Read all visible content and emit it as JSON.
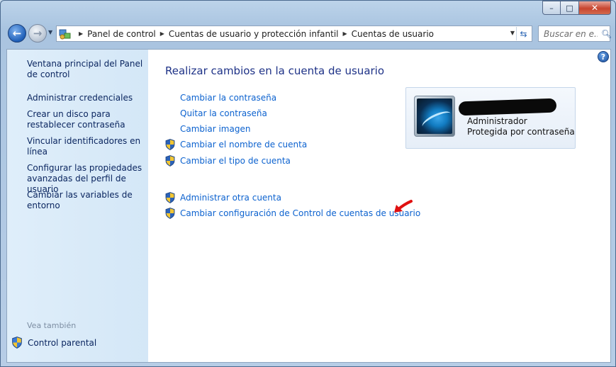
{
  "address": {
    "crumbs": [
      "Panel de control",
      "Cuentas de usuario y protección infantil",
      "Cuentas de usuario"
    ]
  },
  "search": {
    "placeholder": "Buscar en e..."
  },
  "sidebar": {
    "items": [
      {
        "label": "Ventana principal del Panel de control"
      },
      {
        "label": "Administrar credenciales"
      },
      {
        "label": "Crear un disco para restablecer contraseña"
      },
      {
        "label": "Vincular identificadores en línea"
      },
      {
        "label": "Configurar las propiedades avanzadas del perfil de usuario"
      },
      {
        "label": "Cambiar las variables de entorno"
      }
    ],
    "see_also_label": "Vea también",
    "parental_label": "Control parental"
  },
  "main": {
    "heading": "Realizar cambios en la cuenta de usuario",
    "links": [
      {
        "label": "Cambiar la contraseña"
      },
      {
        "label": "Quitar la contraseña"
      },
      {
        "label": "Cambiar imagen"
      },
      {
        "label": "Cambiar el nombre de cuenta"
      },
      {
        "label": "Cambiar el tipo de cuenta"
      },
      {
        "label": "Administrar otra cuenta"
      },
      {
        "label": "Cambiar configuración de Control de cuentas de usuario"
      }
    ],
    "account": {
      "type": "Administrador",
      "protection": "Protegida por contraseña"
    }
  },
  "icons": {
    "back": "back-arrow-icon",
    "forward": "forward-arrow-icon",
    "shield": "uac-shield-icon",
    "help": "help-icon",
    "search": "search-icon",
    "refresh": "refresh-icon"
  },
  "colors": {
    "link": "#0c62cf",
    "heading": "#1e3287",
    "sidebar_text": "#0b2660",
    "arrow": "#e01010"
  }
}
